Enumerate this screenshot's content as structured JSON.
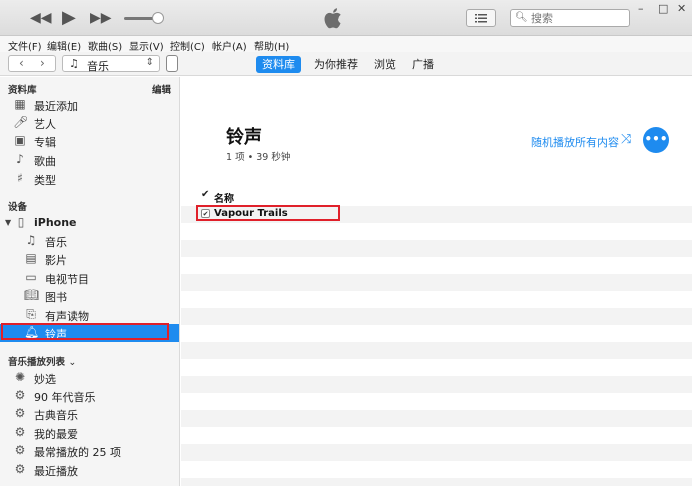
{
  "search": {
    "placeholder": "搜索"
  },
  "window_controls": {
    "minimize": "–",
    "maximize": "□",
    "close": "✕"
  },
  "menu": [
    "文件(F)",
    "编辑(E)",
    "歌曲(S)",
    "显示(V)",
    "控制(C)",
    "帐户(A)",
    "帮助(H)"
  ],
  "toolbar": {
    "back": "‹",
    "forward": "›",
    "media_selector": "音乐",
    "tabs": [
      "资料库",
      "为你推荐",
      "浏览",
      "广播"
    ],
    "active_tab": "资料库"
  },
  "sidebar": {
    "library_title": "资料库",
    "edit_label": "编辑",
    "library_items": [
      {
        "label": "最近添加",
        "icon": "calendar-icon"
      },
      {
        "label": "艺人",
        "icon": "microphone-icon"
      },
      {
        "label": "专辑",
        "icon": "album-icon"
      },
      {
        "label": "歌曲",
        "icon": "music-note-icon"
      },
      {
        "label": "类型",
        "icon": "genre-icon"
      }
    ],
    "devices_title": "设备",
    "device_name": "iPhone",
    "device_items": [
      {
        "label": "音乐",
        "icon": "music-note-icon"
      },
      {
        "label": "影片",
        "icon": "film-icon"
      },
      {
        "label": "电视节目",
        "icon": "tv-icon"
      },
      {
        "label": "图书",
        "icon": "book-icon"
      },
      {
        "label": "有声读物",
        "icon": "audiobook-icon"
      },
      {
        "label": "铃声",
        "icon": "bell-icon",
        "selected": true
      }
    ],
    "playlists_title": "音乐播放列表",
    "playlist_items": [
      {
        "label": "妙选"
      },
      {
        "label": "90 年代音乐"
      },
      {
        "label": "古典音乐"
      },
      {
        "label": "我的最爱"
      },
      {
        "label": "最常播放的 25 项"
      },
      {
        "label": "最近播放"
      }
    ]
  },
  "main": {
    "title": "铃声",
    "subtitle": "1 项 • 39 秒钟",
    "shuffle_label": "随机播放所有内容",
    "more_label": "•••",
    "column_name": "名称",
    "rows": [
      {
        "name": "Vapour Trails",
        "checked": true
      }
    ]
  },
  "colors": {
    "accent": "#1e8bef",
    "highlight_box": "#e0202a"
  }
}
